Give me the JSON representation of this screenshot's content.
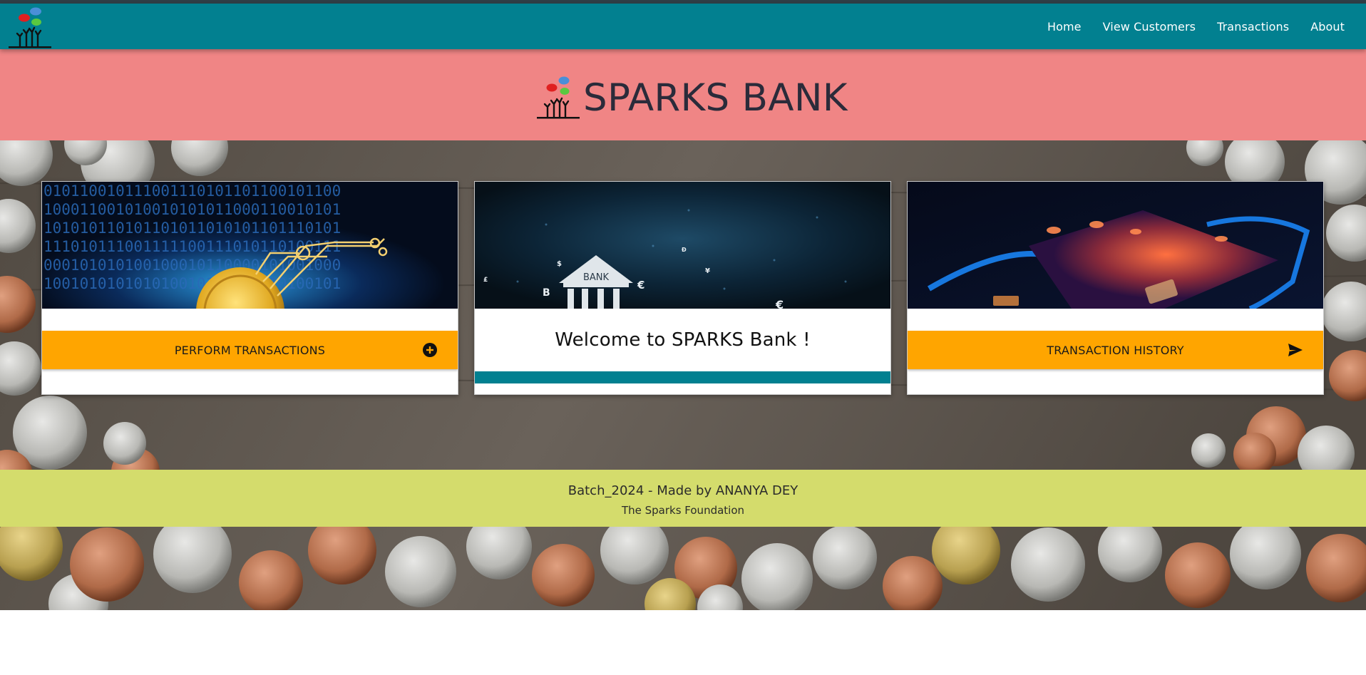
{
  "navbar": {
    "logo_icon": "sparks-foundation-logo-icon",
    "links": [
      "Home",
      "View Customers",
      "Transactions",
      "About"
    ],
    "background": "#028090"
  },
  "banner": {
    "title": "SPARKS BANK",
    "logo_icon": "sparks-foundation-logo-icon",
    "background": "#f08585"
  },
  "cards": [
    {
      "image": "bitcoin-binary-circuit-image",
      "button_label": "PERFORM TRANSACTIONS",
      "button_icon": "plus-circle-icon"
    },
    {
      "image": "bank-building-digital-image",
      "image_text": "BANK",
      "welcome_text": "Welcome to SPARKS Bank !"
    },
    {
      "image": "credit-card-phone-image",
      "button_label": "TRANSACTION HISTORY",
      "button_icon": "send-arrow-icon"
    }
  ],
  "colors": {
    "accent": "#ffa500",
    "teal": "#028090",
    "footer": "#d4dc6c"
  },
  "footer": {
    "line1": "Batch_2024 - Made by ANANYA DEY",
    "line2": "The Sparks Foundation"
  }
}
